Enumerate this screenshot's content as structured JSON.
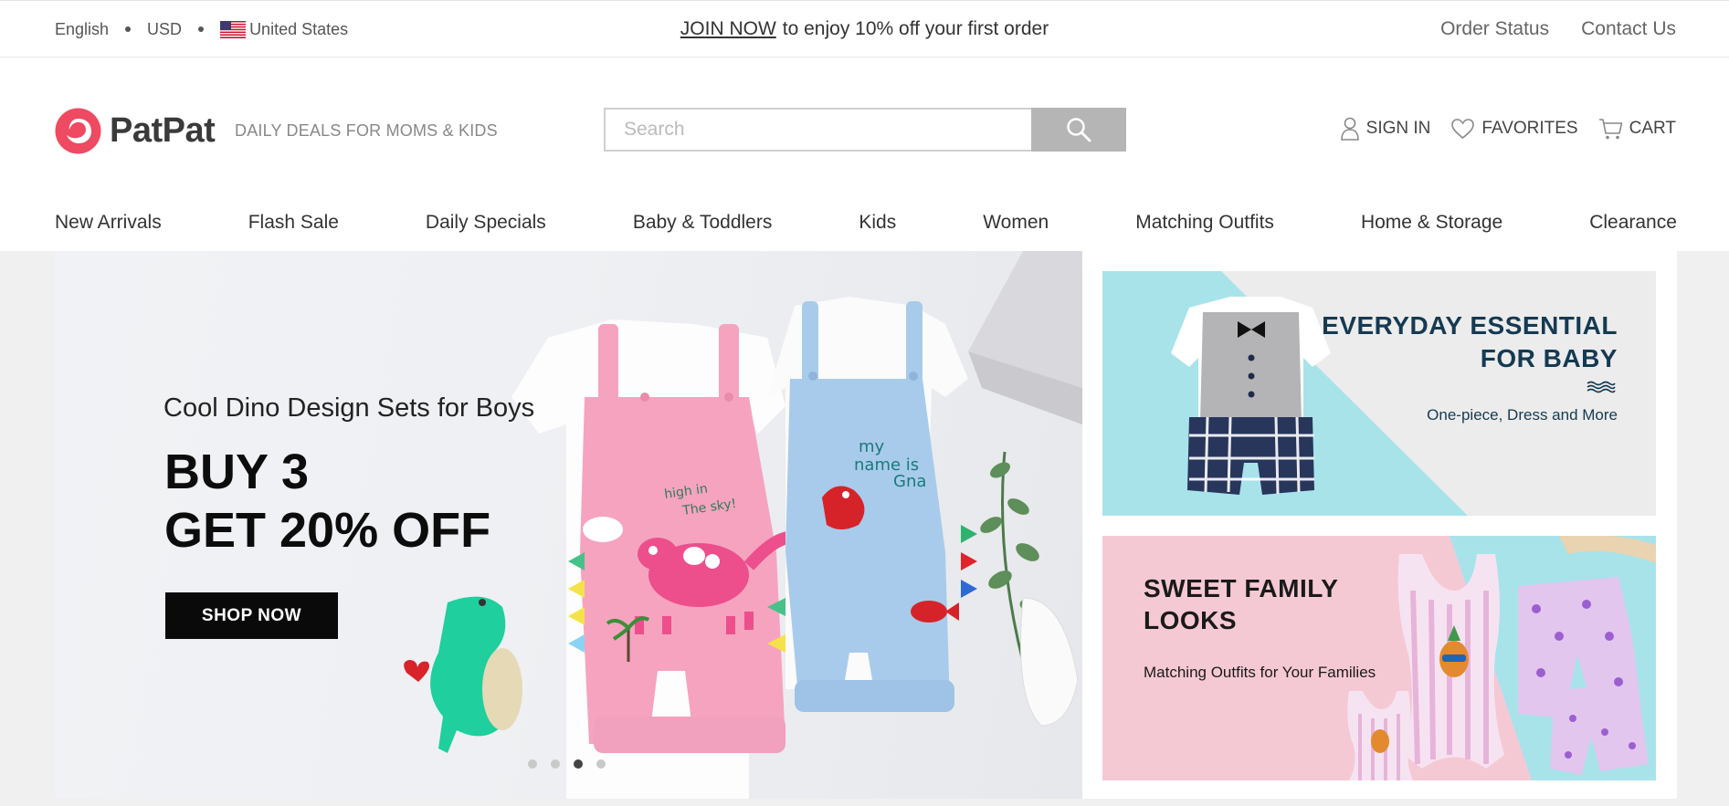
{
  "topbar": {
    "language": "English",
    "currency": "USD",
    "country": "United States",
    "promo_link": "JOIN NOW",
    "promo_text": "to enjoy 10% off your first order",
    "order_status": "Order Status",
    "contact_us": "Contact Us"
  },
  "header": {
    "logo_text": "PatPat",
    "tagline": "DAILY DEALS FOR MOMS & KIDS",
    "search_placeholder": "Search",
    "sign_in": "SIGN IN",
    "favorites": "FAVORITES",
    "cart": "CART"
  },
  "nav": {
    "items": [
      {
        "label": "New Arrivals"
      },
      {
        "label": "Flash Sale"
      },
      {
        "label": "Daily Specials"
      },
      {
        "label": "Baby & Toddlers"
      },
      {
        "label": "Kids"
      },
      {
        "label": "Women"
      },
      {
        "label": "Matching Outfits"
      },
      {
        "label": "Home & Storage"
      },
      {
        "label": "Clearance"
      }
    ]
  },
  "hero": {
    "subtitle": "Cool Dino Design Sets for Boys",
    "headline_line1": "BUY 3",
    "headline_line2": "GET 20% OFF",
    "button": "SHOP NOW",
    "slides_count": 4,
    "active_slide": 3,
    "shirt_text_pink_1": "high  in",
    "shirt_text_pink_2": "The sky!",
    "shirt_text_blue_1": "my",
    "shirt_text_blue_2": "name  is",
    "shirt_text_blue_3": "Gna"
  },
  "promo_cards": [
    {
      "title_line1": "EVERYDAY ESSENTIAL",
      "title_line2": "FOR BABY",
      "subtitle": "One-piece, Dress and More"
    },
    {
      "title_line1": "SWEET FAMILY",
      "title_line2": "LOOKS",
      "subtitle": "Matching Outfits for Your Families"
    }
  ],
  "colors": {
    "brand": "#ee4a62",
    "search_button": "#b5b5b5",
    "hero_button": "#0a0a0a",
    "card1_accent": "#a8e3ea",
    "card2_accent": "#f5c9d4"
  }
}
